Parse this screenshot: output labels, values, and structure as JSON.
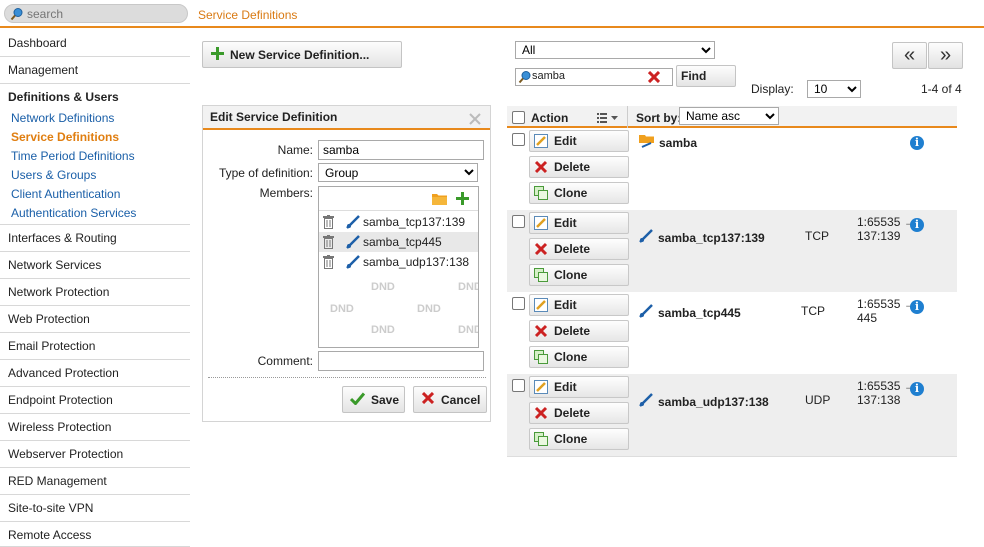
{
  "search": {
    "placeholder": "search"
  },
  "page_title": "Service Definitions",
  "sidebar": {
    "items_top": [
      {
        "label": "Dashboard",
        "name": "sidebar-item-dashboard"
      },
      {
        "label": "Management",
        "name": "sidebar-item-management"
      }
    ],
    "group": {
      "title": "Definitions & Users",
      "subitems": [
        {
          "label": "Network Definitions",
          "name": "sidebar-sub-network-definitions"
        },
        {
          "label": "Service Definitions",
          "name": "sidebar-sub-service-definitions"
        },
        {
          "label": "Time Period Definitions",
          "name": "sidebar-sub-time-period-definitions"
        },
        {
          "label": "Users & Groups",
          "name": "sidebar-sub-users-groups"
        },
        {
          "label": "Client Authentication",
          "name": "sidebar-sub-client-authentication"
        },
        {
          "label": "Authentication Services",
          "name": "sidebar-sub-authentication-services"
        }
      ]
    },
    "items_bottom": [
      {
        "label": "Interfaces & Routing",
        "name": "sidebar-item-interfaces-routing"
      },
      {
        "label": "Network Services",
        "name": "sidebar-item-network-services"
      },
      {
        "label": "Network Protection",
        "name": "sidebar-item-network-protection"
      },
      {
        "label": "Web Protection",
        "name": "sidebar-item-web-protection"
      },
      {
        "label": "Email Protection",
        "name": "sidebar-item-email-protection"
      },
      {
        "label": "Advanced Protection",
        "name": "sidebar-item-advanced-protection"
      },
      {
        "label": "Endpoint Protection",
        "name": "sidebar-item-endpoint-protection"
      },
      {
        "label": "Wireless Protection",
        "name": "sidebar-item-wireless-protection"
      },
      {
        "label": "Webserver Protection",
        "name": "sidebar-item-webserver-protection"
      },
      {
        "label": "RED Management",
        "name": "sidebar-item-red-management"
      },
      {
        "label": "Site-to-site VPN",
        "name": "sidebar-item-site-to-site-vpn"
      },
      {
        "label": "Remote Access",
        "name": "sidebar-item-remote-access"
      }
    ]
  },
  "new_button": {
    "label": "New Service Definition..."
  },
  "edit": {
    "title": "Edit Service Definition",
    "name_label": "Name:",
    "name_value": "samba",
    "type_label": "Type of definition:",
    "type_value": "Group",
    "members_label": "Members:",
    "members": [
      "samba_tcp137:139",
      "samba_tcp445",
      "samba_udp137:138"
    ],
    "dnd_text": "DND",
    "comment_label": "Comment:",
    "comment_value": "",
    "save_label": "Save",
    "cancel_label": "Cancel"
  },
  "list": {
    "filter_value": "All",
    "search_value": "samba",
    "find_label": "Find",
    "display_label": "Display:",
    "display_value": "10",
    "count_text": "1-4 of 4",
    "header": {
      "action_label": "Action",
      "sortby_label": "Sort by:",
      "sort_value": "Name asc"
    },
    "action_labels": {
      "edit": "Edit",
      "delete": "Delete",
      "clone": "Clone"
    },
    "rows": [
      {
        "name": "samba",
        "protocol": "",
        "ports": ""
      },
      {
        "name": "samba_tcp137:139",
        "protocol": "TCP",
        "ports": "1:65535 → 137:139"
      },
      {
        "name": "samba_tcp445",
        "protocol": "TCP",
        "ports": "1:65535 → 445"
      },
      {
        "name": "samba_udp137:138",
        "protocol": "UDP",
        "ports": "1:65535 → 137:138"
      }
    ]
  },
  "colors": {
    "accent": "#e8891c",
    "link": "#1a5fa8",
    "active": "#e07e10",
    "info": "#1f7fd0",
    "delete": "#cc2222",
    "add": "#3a9a2a"
  },
  "icons": [
    "magnifier-icon",
    "plus-icon",
    "close-icon",
    "folder-icon",
    "trash-icon",
    "service-icon",
    "group-icon",
    "info-icon",
    "edit-icon",
    "delete-icon",
    "clone-icon",
    "checkmark-icon",
    "list-icon",
    "double-chevron-left-icon",
    "double-chevron-right-icon"
  ]
}
